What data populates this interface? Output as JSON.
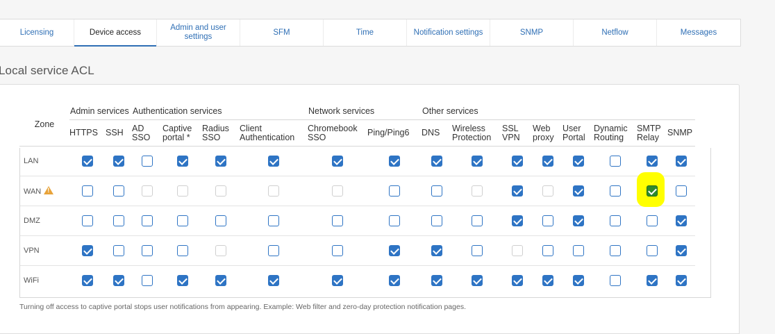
{
  "tabs": [
    {
      "label": "Licensing",
      "width": 107
    },
    {
      "label": "Device access",
      "width": 119,
      "active": true
    },
    {
      "label": "Admin and user settings",
      "width": 120
    },
    {
      "label": "SFM",
      "width": 120
    },
    {
      "label": "Time",
      "width": 120
    },
    {
      "label": "Notification settings",
      "width": 120
    },
    {
      "label": "SNMP",
      "width": 120
    },
    {
      "label": "Netflow",
      "width": 120
    },
    {
      "label": "Messages",
      "width": 120
    }
  ],
  "section_title": "Local service ACL",
  "table": {
    "zone_header": "Zone",
    "groups": [
      {
        "label": "Admin services",
        "span": 2
      },
      {
        "label": "Authentication services",
        "span": 4
      },
      {
        "label": "Network services",
        "span": 2
      },
      {
        "label": "Other services",
        "span": 8
      }
    ],
    "columns": [
      "HTTPS",
      "SSH",
      "AD SSO",
      "Captive portal *",
      "Radius SSO",
      "Client Authentication",
      "Chromebook SSO",
      "Ping/Ping6",
      "DNS",
      "Wireless Protection",
      "SSL VPN",
      "Web proxy",
      "User Portal",
      "Dynamic Routing",
      "SMTP Relay",
      "SNMP"
    ],
    "rows": [
      {
        "zone": "LAN",
        "warning": false,
        "cells": [
          "on",
          "on",
          "off",
          "on",
          "on",
          "on",
          "on",
          "on",
          "on",
          "on",
          "on",
          "on",
          "on",
          "off",
          "on",
          "on"
        ]
      },
      {
        "zone": "WAN",
        "warning": true,
        "cells": [
          "off",
          "off",
          "dis",
          "dis",
          "dis",
          "dis",
          "dis",
          "off",
          "off",
          "dis",
          "on",
          "dis",
          "on",
          "off",
          "on-hl",
          "off"
        ]
      },
      {
        "zone": "DMZ",
        "warning": false,
        "cells": [
          "off",
          "off",
          "off",
          "off",
          "off",
          "off",
          "off",
          "off",
          "off",
          "off",
          "on",
          "off",
          "on",
          "off",
          "off",
          "on"
        ]
      },
      {
        "zone": "VPN",
        "warning": false,
        "cells": [
          "on",
          "off",
          "off",
          "off",
          "dis",
          "off",
          "off",
          "on",
          "on",
          "off",
          "dis",
          "off",
          "off",
          "off",
          "off",
          "on"
        ]
      },
      {
        "zone": "WiFi",
        "warning": false,
        "cells": [
          "on",
          "on",
          "off",
          "on",
          "on",
          "on",
          "on",
          "on",
          "on",
          "on",
          "on",
          "on",
          "on",
          "off",
          "on",
          "on"
        ]
      }
    ]
  },
  "note": "Turning off access to captive portal stops user notifications from appearing. Example: Web filter and zero-day protection notification pages.",
  "colors": {
    "accent": "#2e74c4",
    "highlight": "#ffff00",
    "warning": "#e8a33a"
  }
}
